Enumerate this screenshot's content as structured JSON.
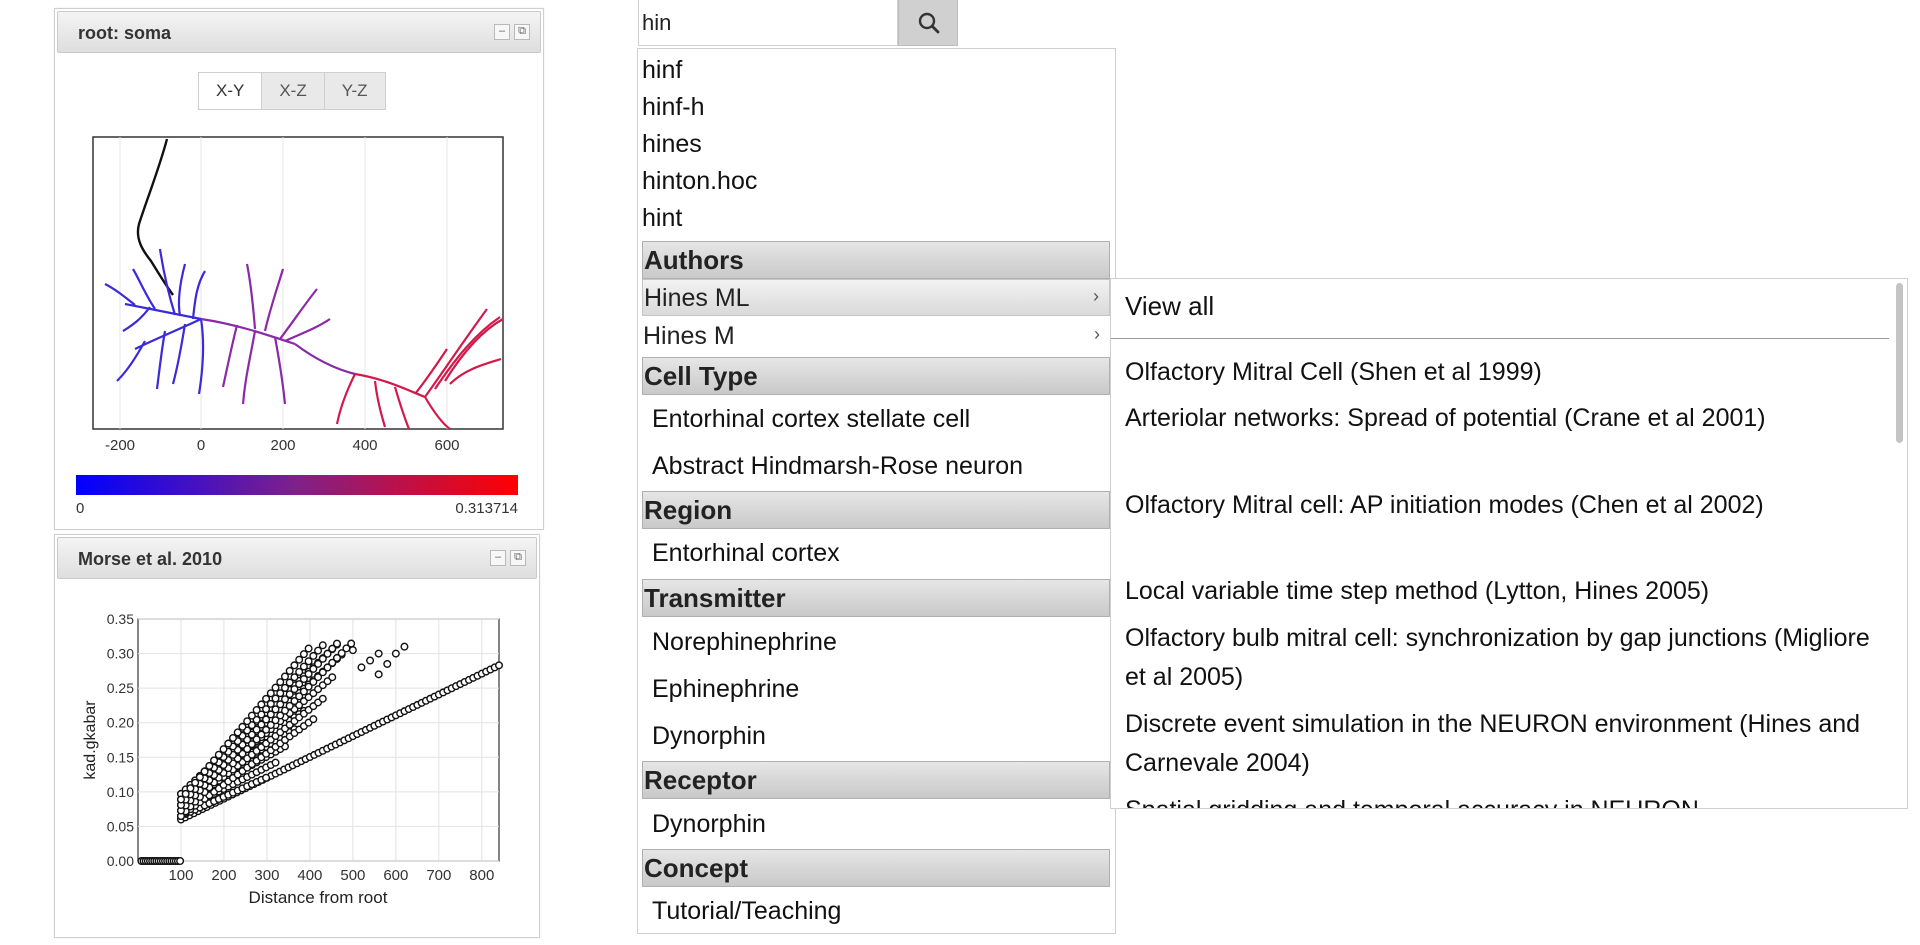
{
  "soma_panel": {
    "title": "root: soma",
    "views": [
      "X-Y",
      "X-Z",
      "Y-Z"
    ],
    "active_view": "X-Y",
    "x_ticks": [
      "-200",
      "0",
      "200",
      "400",
      "600"
    ],
    "colorbar": {
      "min": "0",
      "max": "0.313714",
      "low_color": "#0000ff",
      "high_color": "#ff0000"
    }
  },
  "plot_panel": {
    "title": "Morse et al. 2010",
    "chart_data": {
      "type": "scatter",
      "xlabel": "Distance from root",
      "ylabel": "kad.gkabar",
      "xlim": [
        0,
        840
      ],
      "ylim": [
        0,
        0.35
      ],
      "x_ticks": [
        "100",
        "200",
        "300",
        "400",
        "500",
        "600",
        "700",
        "800"
      ],
      "y_ticks": [
        "0.00",
        "0.05",
        "0.10",
        "0.15",
        "0.20",
        "0.25",
        "0.30",
        "0.35"
      ],
      "grid": true,
      "series_description_points": [
        [
          10,
          0.0
        ],
        [
          40,
          0.0
        ],
        [
          70,
          0.0
        ],
        [
          95,
          0.0
        ],
        [
          100,
          0.06
        ],
        [
          200,
          0.087
        ],
        [
          300,
          0.113
        ],
        [
          400,
          0.14
        ],
        [
          500,
          0.167
        ],
        [
          600,
          0.194
        ],
        [
          700,
          0.22
        ],
        [
          800,
          0.247
        ],
        [
          840,
          0.283
        ],
        [
          100,
          0.09
        ],
        [
          200,
          0.19
        ],
        [
          300,
          0.22
        ],
        [
          400,
          0.26
        ],
        [
          450,
          0.28
        ],
        [
          500,
          0.3
        ],
        [
          620,
          0.31
        ]
      ]
    }
  },
  "search": {
    "query": "hin",
    "button_icon": "search-icon"
  },
  "suggestions": [
    "hinf",
    "hinf-h",
    "hines",
    "hinton.hoc",
    "hint"
  ],
  "categories": {
    "authors": {
      "label": "Authors",
      "items": [
        "Hines ML",
        "Hines M"
      ]
    },
    "cell_type": {
      "label": "Cell Type",
      "items": [
        "Entorhinal cortex stellate cell",
        "Abstract Hindmarsh-Rose neuron"
      ]
    },
    "region": {
      "label": "Region",
      "items": [
        "Entorhinal cortex"
      ]
    },
    "transmitter": {
      "label": "Transmitter",
      "items": [
        "Norephinephrine",
        "Ephinephrine",
        "Dynorphin"
      ]
    },
    "receptor": {
      "label": "Receptor",
      "items": [
        "Dynorphin"
      ]
    },
    "concept": {
      "label": "Concept",
      "items": [
        "Tutorial/Teaching"
      ]
    }
  },
  "flyout": {
    "view_all": "View all",
    "items": [
      "Olfactory Mitral Cell (Shen et al 1999)",
      "Arteriolar networks: Spread of potential (Crane et al 2001)",
      "Olfactory Mitral cell: AP initiation modes (Chen et al 2002)",
      "Local variable time step method (Lytton, Hines 2005)",
      "Olfactory bulb mitral cell: synchronization by gap junctions (Migliore et al 2005)",
      "Discrete event simulation in the NEURON environment (Hines and Carnevale 2004)",
      "Spatial gridding and temporal accuracy in NEURON"
    ]
  }
}
